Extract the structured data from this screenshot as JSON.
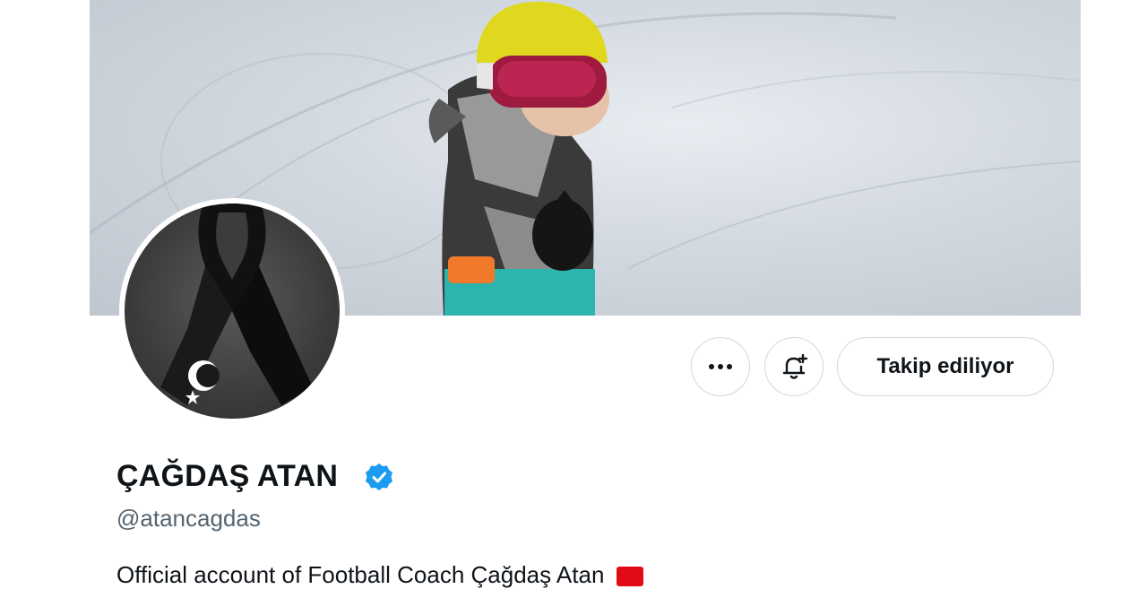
{
  "header": {
    "more_icon": "more-horizontal-icon",
    "notify_icon": "bell-plus-icon",
    "follow_label": "Takip ediliyor"
  },
  "profile": {
    "display_name": "ÇAĞDAŞ ATAN",
    "verified_icon": "verified-badge-icon",
    "handle": "@atancagdas",
    "bio": "Official account of Football Coach Çağdaş Atan",
    "bio_flag_icon": "turkey-flag-icon",
    "avatar_icon": "black-ribbon-turkish-flag-icon"
  },
  "colors": {
    "accent": "#1d9bf0",
    "text_primary": "#0f1419",
    "text_secondary": "#536471",
    "border": "#cfd9de"
  }
}
